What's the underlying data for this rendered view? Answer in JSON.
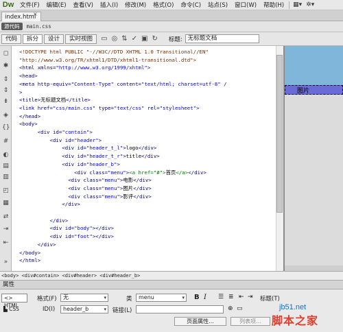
{
  "app": {
    "logo": "Dw"
  },
  "menu": {
    "items": [
      "文件(F)",
      "编辑(E)",
      "查看(V)",
      "插入(I)",
      "修改(M)",
      "格式(O)",
      "命令(C)",
      "站点(S)",
      "窗口(W)",
      "帮助(H)"
    ],
    "layout_icon": "layout-icon",
    "settings_icon": "gear-icon"
  },
  "document_tab": {
    "name": "index.html",
    "close": "×"
  },
  "related_files": {
    "source_code": "源代码",
    "file": "main.css"
  },
  "doc_toolbar": {
    "code": "代码",
    "split": "拆分",
    "design": "设计",
    "live_view": "实时视图",
    "title_label": "标题:",
    "title_value": "无标题文档"
  },
  "code_lines": [
    [
      [
        "doct",
        "<!DOCTYPE html PUBLIC \"-//W3C//DTD XHTML 1.0 Transitional//EN\""
      ]
    ],
    [
      [
        "doct",
        "\"http://www.w3.org/TR/xhtml1/DTD/xhtml1-transitional.dtd\">"
      ]
    ],
    [
      [
        "tag",
        "<html "
      ],
      [
        "attr",
        "xmlns="
      ],
      [
        "val",
        "\"http://www.w3.org/1999/xhtml\""
      ],
      [
        "tag",
        ">"
      ]
    ],
    [
      [
        "tag",
        "<head>"
      ]
    ],
    [
      [
        "tag",
        "<meta "
      ],
      [
        "attr",
        "http-equiv="
      ],
      [
        "val",
        "\"Content-Type\""
      ],
      [
        "attr",
        " content="
      ],
      [
        "val",
        "\"text/html; charset=utf-8\""
      ],
      [
        "tag",
        " /"
      ]
    ],
    [
      [
        "tag",
        ">"
      ]
    ],
    [
      [
        "tag",
        "<title>"
      ],
      [
        "txt",
        "无标题文档"
      ],
      [
        "tag",
        "</title>"
      ]
    ],
    [
      [
        "tag",
        "<link "
      ],
      [
        "attr",
        "href="
      ],
      [
        "val",
        "\"css/main.css\""
      ],
      [
        "attr",
        " type="
      ],
      [
        "val",
        "\"text/css\""
      ],
      [
        "attr",
        " rel="
      ],
      [
        "val",
        "\"stylesheet\""
      ],
      [
        "tag",
        ">"
      ]
    ],
    [
      [
        "tag",
        "</head>"
      ]
    ],
    [
      [
        "tag",
        "<body>"
      ]
    ],
    [
      [
        "txt",
        "      "
      ],
      [
        "tag",
        "<div "
      ],
      [
        "attr",
        "id="
      ],
      [
        "val",
        "\"contain\""
      ],
      [
        "tag",
        ">"
      ]
    ],
    [
      [
        "txt",
        "          "
      ],
      [
        "tag",
        "<div "
      ],
      [
        "attr",
        "id="
      ],
      [
        "val",
        "\"header\""
      ],
      [
        "tag",
        ">"
      ]
    ],
    [
      [
        "txt",
        "              "
      ],
      [
        "tag",
        "<div "
      ],
      [
        "attr",
        "id="
      ],
      [
        "val",
        "\"header_t_l\""
      ],
      [
        "tag",
        ">"
      ],
      [
        "txt",
        "logo"
      ],
      [
        "tag",
        "</div>"
      ]
    ],
    [
      [
        "txt",
        "              "
      ],
      [
        "tag",
        "<div "
      ],
      [
        "attr",
        "id="
      ],
      [
        "val",
        "\"header_t_r\""
      ],
      [
        "tag",
        ">"
      ],
      [
        "txt",
        "title"
      ],
      [
        "tag",
        "</div>"
      ]
    ],
    [
      [
        "txt",
        "              "
      ],
      [
        "tag",
        "<div "
      ],
      [
        "attr",
        "id="
      ],
      [
        "val",
        "\"header_b\""
      ],
      [
        "tag",
        ">"
      ]
    ],
    [
      [
        "txt",
        "                  "
      ],
      [
        "tag",
        "<div "
      ],
      [
        "attr",
        "class="
      ],
      [
        "val",
        "\"menu\""
      ],
      [
        "tag",
        ">"
      ],
      [
        "anc",
        "<a href=\"#\">"
      ],
      [
        "txt",
        "首页"
      ],
      [
        "anc",
        "</a>"
      ],
      [
        "tag",
        "</div>"
      ]
    ],
    [
      [
        "txt",
        "                "
      ],
      [
        "tag",
        "<div "
      ],
      [
        "attr",
        "class="
      ],
      [
        "val",
        "\"menu\""
      ],
      [
        "tag",
        ">"
      ],
      [
        "txt",
        "电影"
      ],
      [
        "tag",
        "</div>"
      ]
    ],
    [
      [
        "txt",
        "                "
      ],
      [
        "tag",
        "<div "
      ],
      [
        "attr",
        "class="
      ],
      [
        "val",
        "\"menu\""
      ],
      [
        "tag",
        ">"
      ],
      [
        "txt",
        "图片"
      ],
      [
        "tag",
        "</div>"
      ]
    ],
    [
      [
        "txt",
        "                "
      ],
      [
        "tag",
        "<div "
      ],
      [
        "attr",
        "class="
      ],
      [
        "val",
        "\"menu\""
      ],
      [
        "tag",
        ">"
      ],
      [
        "txt",
        "影评"
      ],
      [
        "tag",
        "</div>"
      ]
    ],
    [
      [
        "txt",
        "              "
      ],
      [
        "tag",
        "</div>"
      ]
    ],
    [
      [
        "txt",
        ""
      ]
    ],
    [
      [
        "txt",
        "          "
      ],
      [
        "tag",
        "</div>"
      ]
    ],
    [
      [
        "txt",
        "          "
      ],
      [
        "tag",
        "<div "
      ],
      [
        "attr",
        "id="
      ],
      [
        "val",
        "\"body\""
      ],
      [
        "tag",
        "></div>"
      ]
    ],
    [
      [
        "txt",
        "          "
      ],
      [
        "tag",
        "<div "
      ],
      [
        "attr",
        "id="
      ],
      [
        "val",
        "\"foot\""
      ],
      [
        "tag",
        "></div>"
      ]
    ],
    [
      [
        "txt",
        "      "
      ],
      [
        "tag",
        "</div>"
      ]
    ],
    [
      [
        "tag",
        "</body>"
      ]
    ],
    [
      [
        "tag",
        "</html>"
      ]
    ]
  ],
  "design_view": {
    "label": "图片"
  },
  "tag_selector": "<body> <div#contain> <div#header> <div#header_b>",
  "properties": {
    "panel_title": "属性",
    "html_button": "HTML",
    "css_button": "CSS",
    "format_label": "格式(F)",
    "format_value": "无",
    "id_label": "ID(I)",
    "id_value": "header_b",
    "class_label": "类",
    "class_value": "menu",
    "link_label": "链接(L)",
    "title_label": "标题(T)",
    "page_props_button": "页面属性...",
    "list_button": "列表项..."
  },
  "watermark": {
    "url": "jb51.net",
    "text": "脚本之家"
  }
}
